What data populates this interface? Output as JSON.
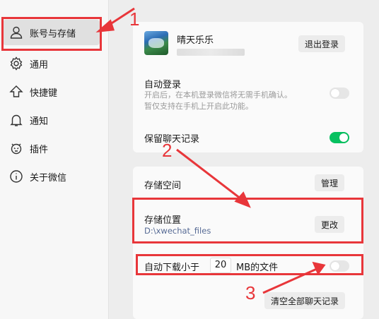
{
  "sidebar": {
    "items": [
      {
        "label": "账号与存储",
        "icon": "person-icon"
      },
      {
        "label": "通用",
        "icon": "gear-icon"
      },
      {
        "label": "快捷键",
        "icon": "up-arrow-icon"
      },
      {
        "label": "通知",
        "icon": "bell-icon"
      },
      {
        "label": "插件",
        "icon": "plugin-icon"
      },
      {
        "label": "关于微信",
        "icon": "info-icon"
      }
    ]
  },
  "account": {
    "username": "晴天乐乐",
    "logout_label": "退出登录",
    "auto_login_title": "自动登录",
    "auto_login_desc_1": "开启后，在本机登录微信将无需手机确认。",
    "auto_login_desc_2": "暂仅支持在手机上开启此功能。",
    "auto_login_enabled": false,
    "keep_history_title": "保留聊天记录",
    "keep_history_enabled": true
  },
  "storage": {
    "space_title": "存储空间",
    "manage_label": "管理",
    "location_title": "存储位置",
    "location_path": "D:\\xwechat_files",
    "change_label": "更改",
    "auto_download_prefix": "自动下载小于",
    "auto_download_value": "20",
    "auto_download_suffix": "MB的文件",
    "auto_download_enabled": false,
    "clear_label": "清空全部聊天记录"
  },
  "annotations": {
    "marker_1": "1",
    "marker_2": "2",
    "marker_3": "3"
  },
  "colors": {
    "highlight": "#e8363a",
    "toggle_on": "#07c160",
    "path": "#576b95"
  }
}
